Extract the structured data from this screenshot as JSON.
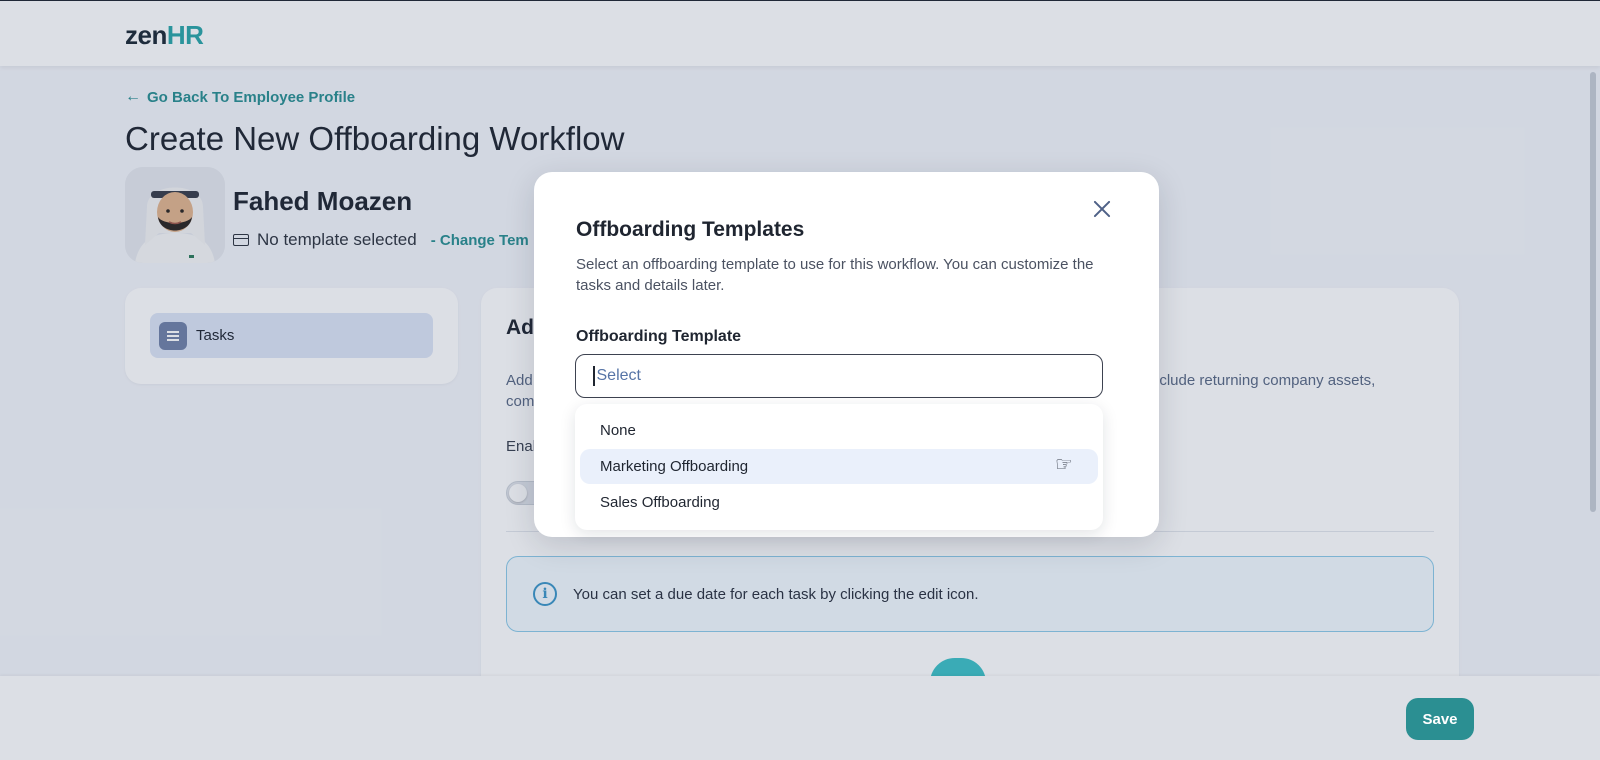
{
  "header": {
    "logo_primary": "zen",
    "logo_accent": "HR"
  },
  "page": {
    "back_link": "Go Back To Employee Profile",
    "title": "Create New Offboarding Workflow"
  },
  "employee": {
    "name": "Fahed Moazen",
    "template_status": "No template selected",
    "change_link": "- Change Tem"
  },
  "sidebar": {
    "items": [
      {
        "label": "Tasks"
      }
    ]
  },
  "main": {
    "heading_partial": "Ad",
    "desc_line1_partial": "Add",
    "desc_line2_partial": "com",
    "desc_tail": "y include returning company assets,",
    "enable_label_partial": "Enal",
    "info_text": "You can set a due date for each task by clicking the edit icon."
  },
  "modal": {
    "title": "Offboarding Templates",
    "description": "Select an offboarding template to use for this workflow. You can customize the tasks and details later.",
    "field_label": "Offboarding Template",
    "select_placeholder": "Select",
    "options": [
      "None",
      "Marketing Offboarding",
      "Sales Offboarding"
    ],
    "highlighted_option": "Marketing Offboarding"
  },
  "footer": {
    "save_label": "Save"
  },
  "colors": {
    "brand_teal": "#2b8f92",
    "logo_accent": "#2ba6a8",
    "sidebar_active": "#dde5f6",
    "info_border": "#8ecbe9"
  }
}
